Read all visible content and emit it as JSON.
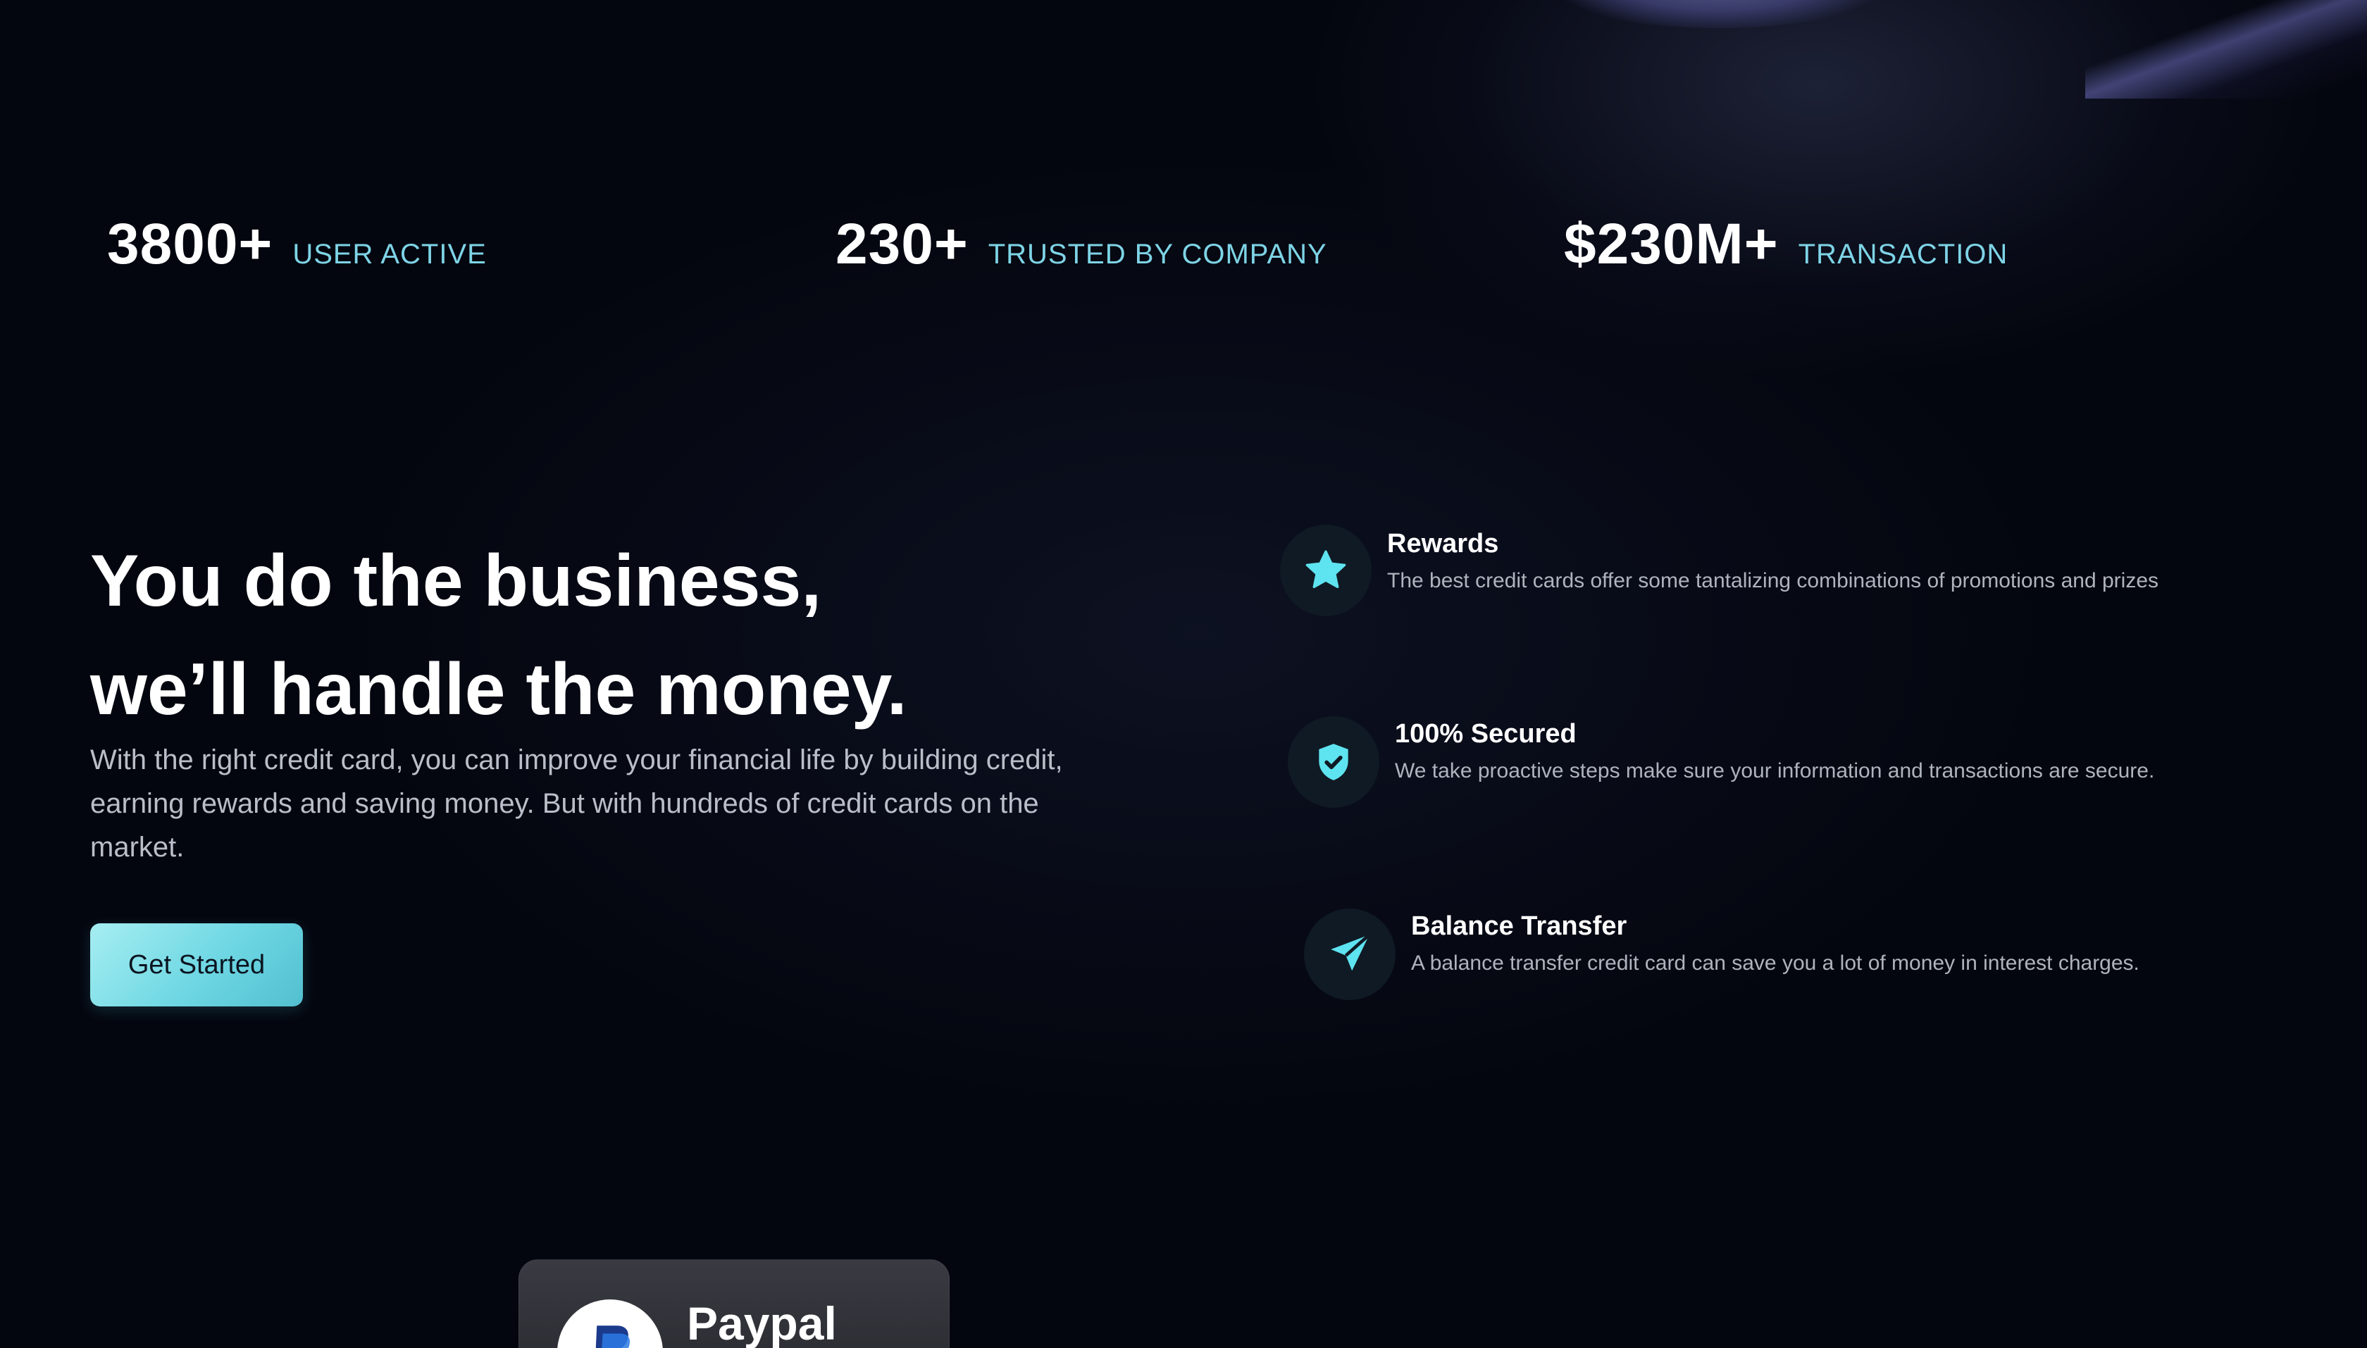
{
  "stats": [
    {
      "number": "3800+",
      "label": "USER ACTIVE"
    },
    {
      "number": "230+",
      "label": "TRUSTED BY COMPANY"
    },
    {
      "number": "$230M+",
      "label": "TRANSACTION"
    }
  ],
  "hero": {
    "title_line1": "You do the business,",
    "title_line2": "we’ll handle the money.",
    "description": "With the right credit card, you can improve your financial life by building credit, earning rewards and saving money. But with hundreds of credit cards on the market.",
    "cta_label": "Get Started"
  },
  "features": [
    {
      "icon": "star-icon",
      "title": "Rewards",
      "description": "The best credit cards offer some tantalizing combinations of promotions and prizes"
    },
    {
      "icon": "shield-check-icon",
      "title": "100% Secured",
      "description": "We take proactive steps make sure your information and transactions are secure."
    },
    {
      "icon": "send-icon",
      "title": "Balance Transfer",
      "description": "A balance transfer credit card can save you a lot of money in interest charges."
    }
  ],
  "payment_card": {
    "name": "Paypal",
    "icon": "paypal-logo-icon"
  },
  "colors": {
    "background": "#04060f",
    "accent": "#7ed4e6",
    "icon_accent": "#5ee3f0",
    "cta_gradient_start": "#a6eef2",
    "cta_gradient_end": "#52bfd0"
  }
}
